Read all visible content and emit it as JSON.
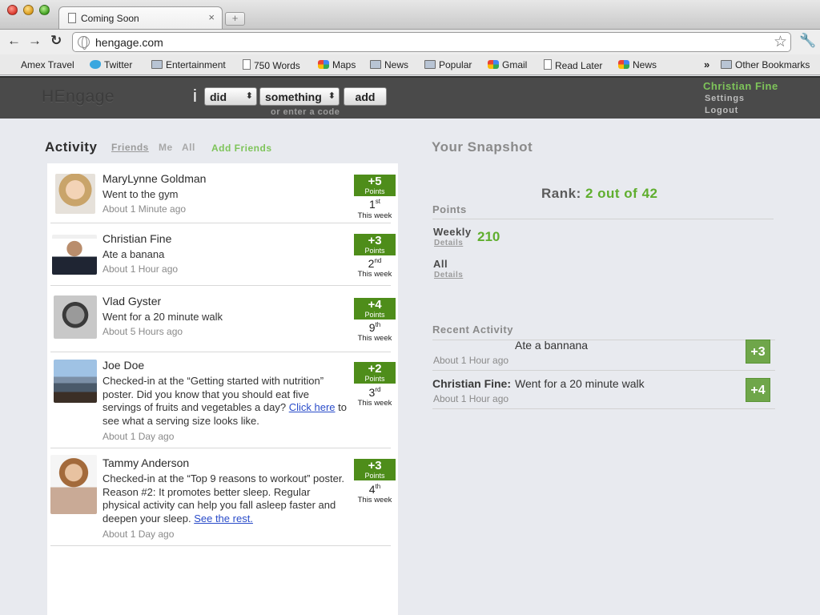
{
  "browser": {
    "tab_title": "Coming Soon",
    "tab_close": "×",
    "new_tab": "+",
    "back": "←",
    "forward": "→",
    "reload": "↻",
    "url": "hengage.com",
    "star": "☆",
    "wrench": "🔧",
    "more": "»",
    "bookmarks": [
      {
        "label": "Amex Travel",
        "icon": "none"
      },
      {
        "label": "Twitter",
        "icon": "bird-icon"
      },
      {
        "label": "Entertainment",
        "icon": "folder-icon"
      },
      {
        "label": "750 Words",
        "icon": "page-icon"
      },
      {
        "label": "Maps",
        "icon": "google-icon"
      },
      {
        "label": "News",
        "icon": "folder-icon"
      },
      {
        "label": "Popular",
        "icon": "folder-icon"
      },
      {
        "label": "Gmail",
        "icon": "google-icon"
      },
      {
        "label": "Read Later",
        "icon": "page-icon"
      },
      {
        "label": "News",
        "icon": "google-icon"
      },
      {
        "label": "Other Bookmarks",
        "icon": "folder-icon"
      }
    ]
  },
  "header": {
    "logo": "HEngage",
    "i_label": "i",
    "verb_select": "did",
    "object_select": "something",
    "select_arrow": "⬍",
    "add_label": "add",
    "code_link": "or enter a code",
    "user_name": "Christian Fine",
    "settings": "Settings",
    "logout": "Logout"
  },
  "activity": {
    "title": "Activity",
    "filters": [
      "Friends",
      "Me",
      "All"
    ],
    "add_friends": "Add Friends",
    "items": [
      {
        "name": "MaryLynne Goldman",
        "text": "Went to the gym",
        "time": "About 1 Minute ago",
        "points": "+5",
        "points_label": "Points",
        "rank": "1",
        "rank_suffix": "st",
        "rank_week": "This week"
      },
      {
        "name": "Christian Fine",
        "text": "Ate a banana",
        "time": "About 1 Hour ago",
        "points": "+3",
        "points_label": "Points",
        "rank": "2",
        "rank_suffix": "nd",
        "rank_week": "This week"
      },
      {
        "name": "Vlad Gyster",
        "text": "Went for a 20 minute walk",
        "time": "About 5 Hours ago",
        "points": "+4",
        "points_label": "Points",
        "rank": "9",
        "rank_suffix": "th",
        "rank_week": "This week"
      },
      {
        "name": "Joe Doe",
        "text_before": "Checked-in at the “Getting started with nutrition” poster. Did you know that you should eat five servings of fruits and vegetables a day? ",
        "link": "Click here",
        "text_after": " to see what a serving size looks like.",
        "time": "About 1 Day ago",
        "points": "+2",
        "points_label": "Points",
        "rank": "3",
        "rank_suffix": "rd",
        "rank_week": "This week"
      },
      {
        "name": "Tammy Anderson",
        "text_before": "Checked-in at the “Top 9 reasons to workout” poster. Reason #2:  It promotes better sleep. Regular physical activity can help you fall asleep faster and deepen your sleep.  ",
        "link": "See the rest.",
        "time": "About 1 Day ago",
        "points": "+3",
        "points_label": "Points",
        "rank": "4",
        "rank_suffix": "th",
        "rank_week": "This week"
      }
    ]
  },
  "snapshot": {
    "title": "Your Snapshot",
    "rank_label": "Rank:",
    "rank_value": "2 out of 42",
    "points_heading": "Points",
    "weekly_label": "Weekly",
    "weekly_value": "210",
    "all_label": "All",
    "details_label": "Details",
    "recent_heading": "Recent Activity",
    "recent": [
      {
        "name": "",
        "text": "Ate a bannana",
        "time": "About 1 Hour ago",
        "points": "+3"
      },
      {
        "name": "Christian Fine:",
        "text": "Went for a 20 minute walk",
        "time": "About 1 Hour ago",
        "points": "+4"
      }
    ]
  },
  "colors": {
    "accent_green": "#5fae2e",
    "points_green": "#4e8d1a",
    "header_bg": "#4a4a4a",
    "link_blue": "#2a4cc9"
  }
}
